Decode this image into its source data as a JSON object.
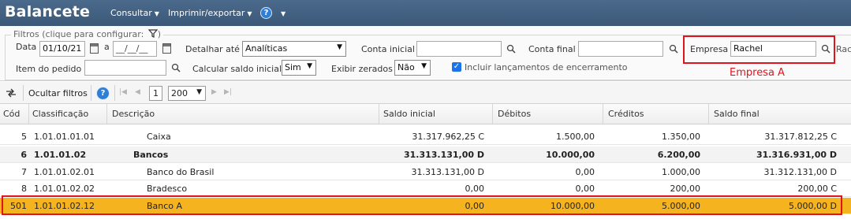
{
  "header": {
    "title": "Balancete",
    "menus": [
      {
        "label": "Consultar"
      },
      {
        "label": "Imprimir/exportar"
      }
    ],
    "help_label": "?"
  },
  "filters": {
    "legend": "Filtros (clique para configurar:",
    "data_label": "Data",
    "date_from": "01/10/21",
    "date_sep": "a",
    "date_to": "__/__/__",
    "detalhar_label": "Detalhar até",
    "detalhar_value": "Analíticas",
    "conta_inicial_label": "Conta inicial",
    "conta_inicial_value": "",
    "conta_final_label": "Conta final",
    "conta_final_value": "",
    "empresa_label": "Empresa",
    "empresa_value": "Rachel",
    "empresa_overflow": "Rach",
    "item_pedido_label": "Item do pedido",
    "item_pedido_value": "",
    "calc_saldo_label": "Calcular saldo inicial",
    "calc_saldo_value": "Sim",
    "exibir_zerados_label": "Exibir zerados",
    "exibir_zerados_value": "Não",
    "incluir_label": "Incluir lançamentos de encerramento",
    "incluir_checked": true,
    "annotation": "Empresa A"
  },
  "toolbar": {
    "ocultar_label": "Ocultar filtros",
    "page_number": "1",
    "page_size": "200"
  },
  "grid": {
    "columns": [
      "Cód",
      "Classificação",
      "Descrição",
      "Saldo inicial",
      "Débitos",
      "Créditos",
      "Saldo final"
    ],
    "rows": [
      {
        "cod": "5",
        "class": "1.01.01.01.01",
        "desc": "Caixa",
        "saldo_inicial": "31.317.962,25 C",
        "debitos": "1.500,00",
        "creditos": "1.350,00",
        "saldo_final": "31.317.812,25 C",
        "bold": false,
        "highlight": false
      },
      {
        "cod": "6",
        "class": "1.01.01.02",
        "desc": "Bancos",
        "saldo_inicial": "31.313.131,00 D",
        "debitos": "10.000,00",
        "creditos": "6.200,00",
        "saldo_final": "31.316.931,00 D",
        "bold": true,
        "highlight": false
      },
      {
        "cod": "7",
        "class": "1.01.01.02.01",
        "desc": "Banco do Brasil",
        "saldo_inicial": "31.313.131,00 D",
        "debitos": "0,00",
        "creditos": "1.000,00",
        "saldo_final": "31.312.131,00 D",
        "bold": false,
        "highlight": false
      },
      {
        "cod": "8",
        "class": "1.01.01.02.02",
        "desc": "Bradesco",
        "saldo_inicial": "0,00",
        "debitos": "0,00",
        "creditos": "200,00",
        "saldo_final": "200,00 C",
        "bold": false,
        "highlight": false
      },
      {
        "cod": "501",
        "class": "1.01.01.02.12",
        "desc": "Banco A",
        "saldo_inicial": "0,00",
        "debitos": "10.000,00",
        "creditos": "5.000,00",
        "saldo_final": "5.000,00 D",
        "bold": false,
        "highlight": true
      }
    ]
  },
  "colors": {
    "header_bg": "#3f5c7e",
    "highlight_row": "#f5b31f",
    "annotation_red": "#e0141e"
  }
}
